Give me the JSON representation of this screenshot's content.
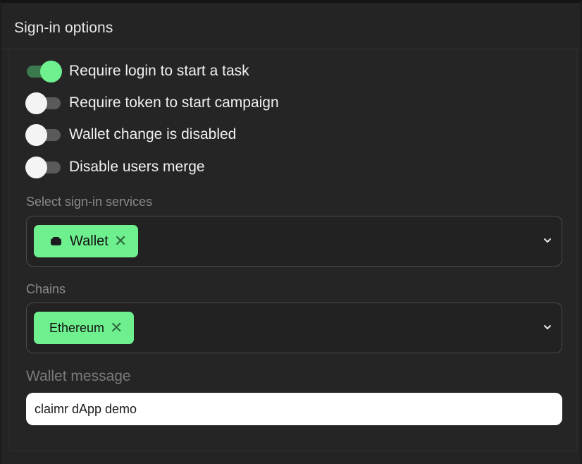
{
  "header": {
    "title": "Sign-in options"
  },
  "toggles": [
    {
      "label": "Require login to start a task",
      "on": true
    },
    {
      "label": "Require token to start campaign",
      "on": false
    },
    {
      "label": "Wallet change is disabled",
      "on": false
    },
    {
      "label": "Disable users merge",
      "on": false
    }
  ],
  "signin_services": {
    "label": "Select sign-in services",
    "chips": [
      {
        "label": "Wallet",
        "icon": "wallet-icon"
      }
    ]
  },
  "chains": {
    "label": "Chains",
    "chips": [
      {
        "label": "Ethereum"
      }
    ]
  },
  "wallet_message": {
    "label": "Wallet message",
    "value": "claimr dApp demo"
  },
  "colors": {
    "accent": "#6ff08f",
    "background": "#242424",
    "toggle_off_track": "#5a5a5a",
    "toggle_on_track": "#3b7a4e"
  }
}
